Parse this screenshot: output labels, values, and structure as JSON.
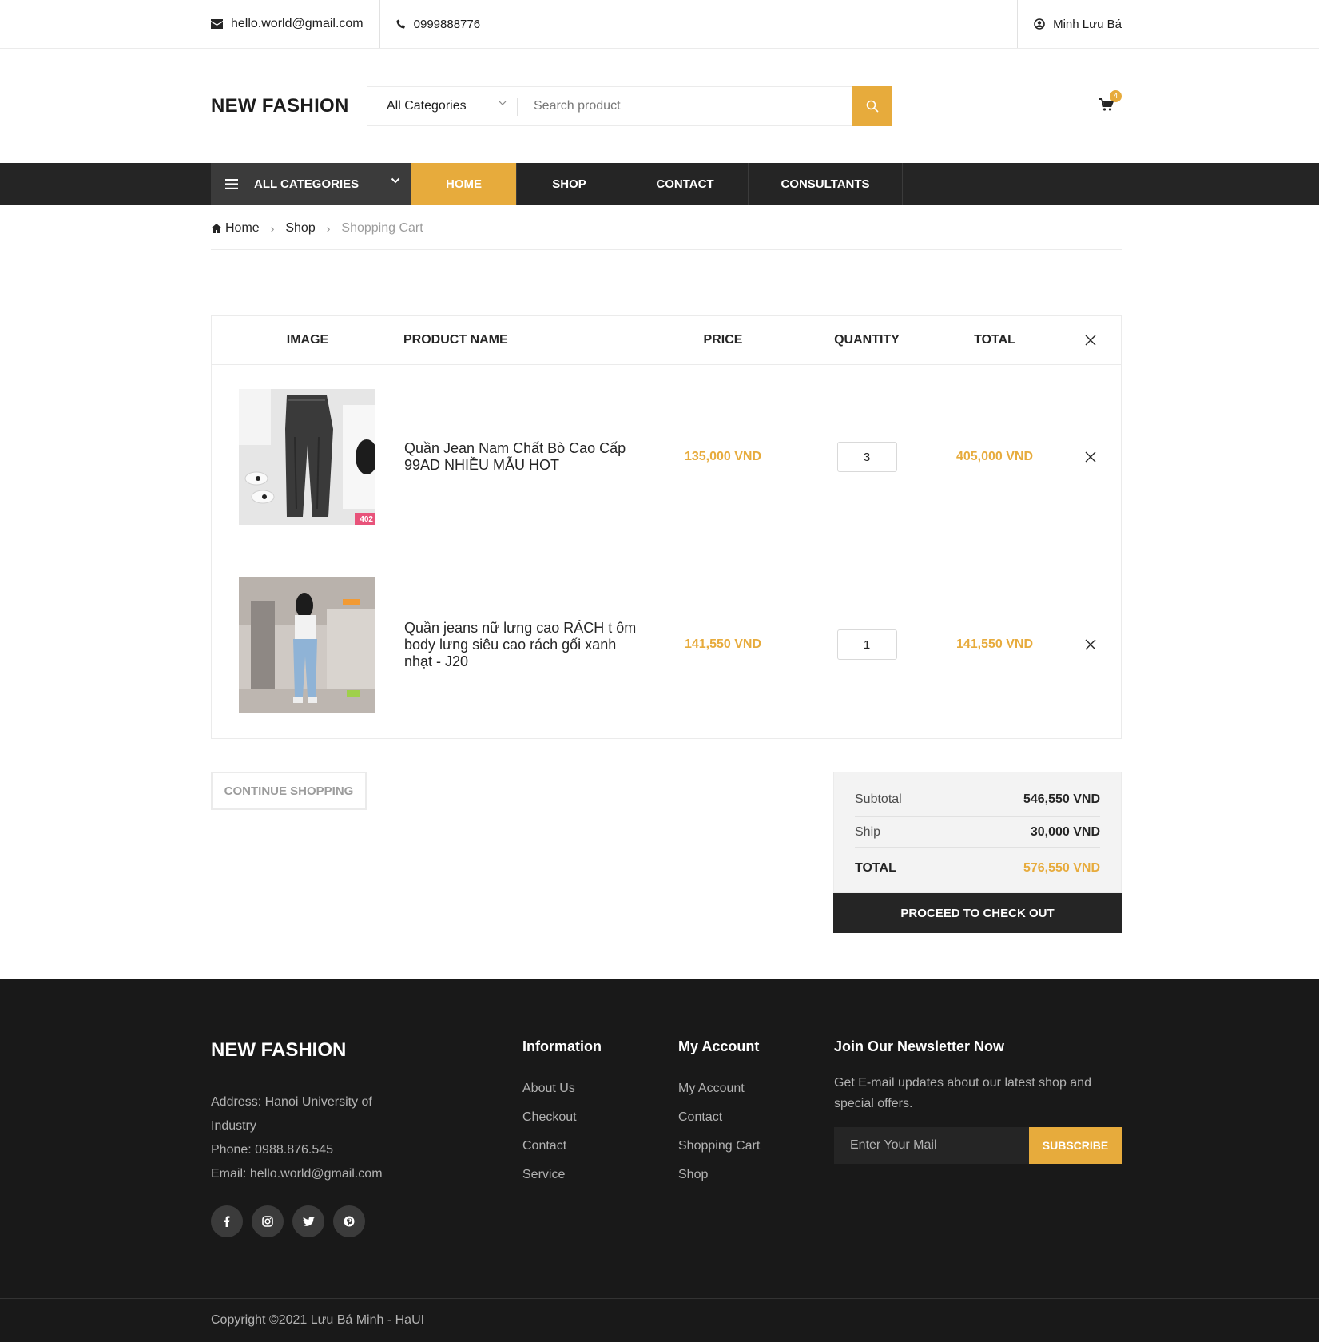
{
  "topbar": {
    "email": "hello.world@gmail.com",
    "phone": "0999888776",
    "user": "Minh Lưu Bá"
  },
  "header": {
    "logo": "NEW FASHION",
    "category_select": "All Categories",
    "search_placeholder": "Search product",
    "cart_count": "4"
  },
  "nav": {
    "all_categories": "ALL CATEGORIES",
    "items": [
      "HOME",
      "SHOP",
      "CONTACT",
      "CONSULTANTS"
    ],
    "active": "HOME",
    "accent_color": "#e7ab3c"
  },
  "breadcrumb": {
    "home": "Home",
    "shop": "Shop",
    "current": "Shopping Cart"
  },
  "cart": {
    "headers": {
      "image": "IMAGE",
      "name": "PRODUCT NAME",
      "price": "PRICE",
      "quantity": "QUANTITY",
      "total": "TOTAL"
    },
    "items": [
      {
        "name": "Quần Jean Nam Chất Bò Cao Cấp 99AD NHIỀU MẪU HOT",
        "price": "135,000 VND",
        "quantity": "3",
        "total": "405,000 VND",
        "image_badge": "402"
      },
      {
        "name": "Quần jeans nữ lưng cao RÁCH t ôm body lưng siêu cao rách gối xanh nhạt - J20",
        "price": "141,550 VND",
        "quantity": "1",
        "total": "141,550 VND"
      }
    ],
    "continue_label": "CONTINUE SHOPPING"
  },
  "summary": {
    "subtotal_label": "Subtotal",
    "subtotal": "546,550  VND",
    "ship_label": "Ship",
    "ship": "30,000  VND",
    "total_label": "TOTAL",
    "total": "576,550  VND",
    "checkout_label": "PROCEED TO CHECK OUT"
  },
  "footer": {
    "logo": "NEW FASHION",
    "address": "Address: Hanoi University of Industry",
    "phone": "Phone: 0988.876.545",
    "email": "Email: hello.world@gmail.com",
    "social": [
      "facebook-icon",
      "instagram-icon",
      "twitter-icon",
      "pinterest-icon"
    ],
    "information": {
      "title": "Information",
      "links": [
        "About Us",
        "Checkout",
        "Contact",
        "Service"
      ]
    },
    "account": {
      "title": "My Account",
      "links": [
        "My Account",
        "Contact",
        "Shopping Cart",
        "Shop"
      ]
    },
    "newsletter": {
      "title": "Join Our Newsletter Now",
      "text": "Get E-mail updates about our latest shop and special offers.",
      "placeholder": "Enter Your Mail",
      "button": "SUBSCRIBE"
    },
    "copyright": "Copyright ©2021 Lưu Bá Minh - HaUI"
  }
}
